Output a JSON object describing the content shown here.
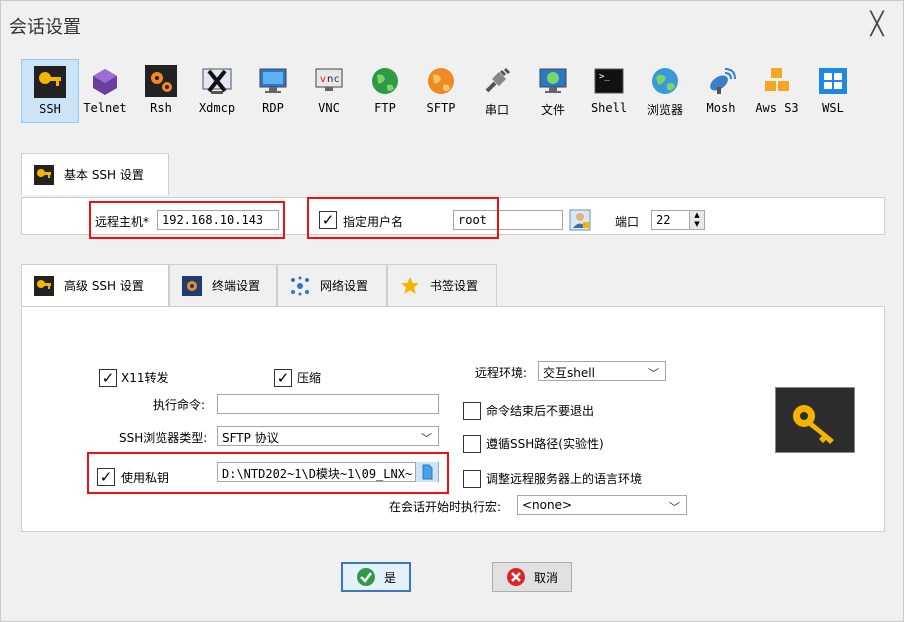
{
  "window": {
    "title": "会话设置",
    "close_glyph": "╳"
  },
  "protocols": [
    {
      "label": "SSH",
      "icon": "key-icon",
      "selected": true
    },
    {
      "label": "Telnet",
      "icon": "telnet-icon"
    },
    {
      "label": "Rsh",
      "icon": "rsh-gears-icon"
    },
    {
      "label": "Xdmcp",
      "icon": "x-icon"
    },
    {
      "label": "RDP",
      "icon": "monitor-icon"
    },
    {
      "label": "VNC",
      "icon": "vnc-icon"
    },
    {
      "label": "FTP",
      "icon": "globe-green-icon"
    },
    {
      "label": "SFTP",
      "icon": "globe-orange-icon"
    },
    {
      "label": "串口",
      "icon": "plug-icon"
    },
    {
      "label": "文件",
      "icon": "file-monitor-icon"
    },
    {
      "label": "Shell",
      "icon": "terminal-icon"
    },
    {
      "label": "浏览器",
      "icon": "browser-globe-icon"
    },
    {
      "label": "Mosh",
      "icon": "satellite-icon"
    },
    {
      "label": "Aws S3",
      "icon": "cubes-icon"
    },
    {
      "label": "WSL",
      "icon": "windows-icon"
    }
  ],
  "basic": {
    "tab_label": "基本 SSH 设置",
    "host_label": "远程主机*",
    "host_value": "192.168.10.143",
    "specify_user_label": "指定用户名",
    "specify_user_checked": true,
    "username_value": "root",
    "port_label": "端口",
    "port_value": "22"
  },
  "adv_tabs": [
    {
      "label": "高级 SSH 设置",
      "icon": "key-icon",
      "active": true
    },
    {
      "label": "终端设置",
      "icon": "terminal-gear-icon"
    },
    {
      "label": "网络设置",
      "icon": "network-icon"
    },
    {
      "label": "书签设置",
      "icon": "star-icon"
    }
  ],
  "advanced": {
    "x11_label": "X11转发",
    "x11_checked": true,
    "compress_label": "压缩",
    "compress_checked": true,
    "exec_cmd_label": "执行命令:",
    "exec_cmd_value": "",
    "ssh_browser_label": "SSH浏览器类型:",
    "ssh_browser_value": "SFTP 协议",
    "private_key_label": "使用私钥",
    "private_key_checked": true,
    "private_key_value": "D:\\NTD202~1\\D模块~1\\09_LNX~",
    "remote_env_label": "远程环境:",
    "remote_env_value": "交互shell",
    "no_exit_label": "命令结束后不要退出",
    "follow_path_label": "遵循SSH路径(实验性)",
    "adjust_lang_label": "调整远程服务器上的语言环境",
    "macro_label": "在会话开始时执行宏:",
    "macro_value": "<none>"
  },
  "buttons": {
    "ok": "是",
    "cancel": "取消"
  },
  "colors": {
    "highlight": "#e11111",
    "selected_bg": "#cce4f7",
    "key_gold": "#f5b400"
  }
}
